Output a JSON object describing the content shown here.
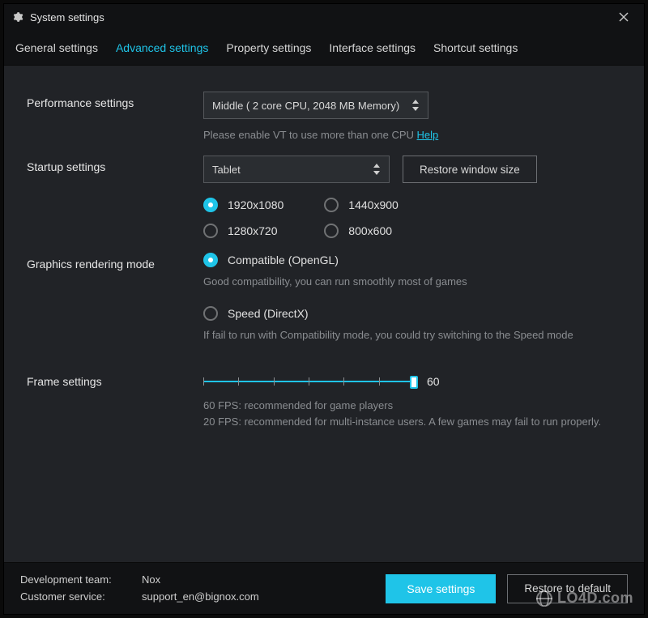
{
  "window": {
    "title": "System settings"
  },
  "tabs": [
    {
      "label": "General settings",
      "active": false
    },
    {
      "label": "Advanced settings",
      "active": true
    },
    {
      "label": "Property settings",
      "active": false
    },
    {
      "label": "Interface settings",
      "active": false
    },
    {
      "label": "Shortcut settings",
      "active": false
    }
  ],
  "performance": {
    "label": "Performance settings",
    "selected": "Middle ( 2 core CPU, 2048 MB Memory)",
    "hint_prefix": "Please enable VT to use more than one CPU ",
    "help_link": "Help"
  },
  "startup": {
    "label": "Startup settings",
    "selected": "Tablet",
    "restore_button": "Restore window size",
    "resolutions": [
      {
        "value": "1920x1080",
        "selected": true
      },
      {
        "value": "1280x720",
        "selected": false
      },
      {
        "value": "1440x900",
        "selected": false
      },
      {
        "value": "800x600",
        "selected": false
      }
    ]
  },
  "graphics": {
    "label": "Graphics rendering mode",
    "options": [
      {
        "name": "Compatible (OpenGL)",
        "selected": true,
        "hint": "Good compatibility, you can run smoothly most of games"
      },
      {
        "name": "Speed (DirectX)",
        "selected": false,
        "hint": " If fail to run with Compatibility mode, you could try switching to the Speed mode"
      }
    ]
  },
  "frame": {
    "label": "Frame settings",
    "value": 60,
    "min": 0,
    "max": 60,
    "ticks": 7,
    "hint_line1": "60 FPS: recommended for game players",
    "hint_line2": "20 FPS: recommended for multi-instance users. A few games may fail to run properly."
  },
  "footer": {
    "dev_label": "Development team:",
    "dev_value": "Nox",
    "cs_label": "Customer service:",
    "cs_value": "support_en@bignox.com",
    "save": "Save settings",
    "restore": "Restore to default"
  },
  "watermark": "LO4D.com"
}
